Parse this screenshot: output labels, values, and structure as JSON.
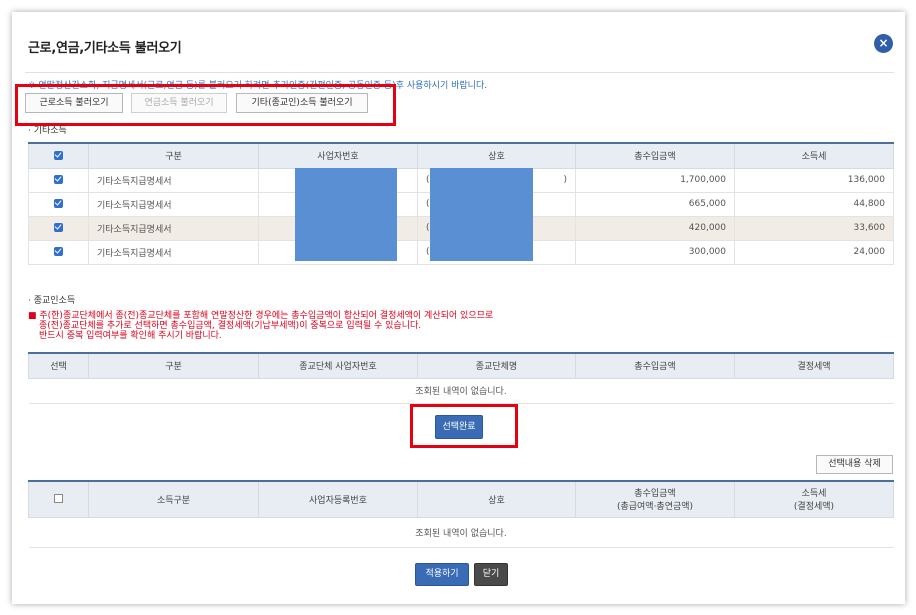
{
  "dialog": {
    "title": "근로,연금,기타소득 불러오기",
    "close_icon": "×",
    "notice": "※ 연말정산간소화, 지급명세서(근로,연금 등)를 불러오기 하려면 추가인증(간편인증, 공동인증 등)후 사용하시기 바랍니다."
  },
  "load_buttons": {
    "earned": "근로소득 불러오기",
    "pension": "연금소득 불러오기",
    "other": "기타(종교인)소득 불러오기"
  },
  "other_income": {
    "label": "· 기타소득",
    "headers": [
      "구분",
      "사업자번호",
      "상호",
      "총수입금액",
      "소득세"
    ],
    "rows": [
      {
        "type": "기타소득지급명세서",
        "biz_no": "",
        "name_prefix": "(",
        "name_suffix": ")",
        "total": "1,700,000",
        "tax": "136,000"
      },
      {
        "type": "기타소득지급명세서",
        "biz_no": "",
        "name_prefix": "(",
        "name_suffix": "",
        "total": "665,000",
        "tax": "44,800"
      },
      {
        "type": "기타소득지급명세서",
        "biz_no": "",
        "name_prefix": "(",
        "name_suffix": "",
        "total": "420,000",
        "tax": "33,600"
      },
      {
        "type": "기타소득지급명세서",
        "biz_no": "",
        "name_prefix": "(",
        "name_suffix": "",
        "total": "300,000",
        "tax": "24,000"
      }
    ]
  },
  "religious_income": {
    "label": "· 종교인소득",
    "warning_lines": [
      "■ 주(한)종교단체에서 종(전)종교단체를 포함해 연말정산한 경우에는 총수입금액이 합산되어 결정세액이 계산되어 있으므로",
      "종(전)종교단체를 추가로 선택하면 총수입금액, 결정세액(기납부세액)이 중복으로 입력될 수 있습니다.",
      "반드시 중복 입력여부를 확인해 주시기 바랍니다."
    ],
    "headers": [
      "선택",
      "구분",
      "종교단체 사업자번호",
      "종교단체명",
      "총수입금액",
      "결정세액"
    ],
    "empty_text": "조회된 내역이 없습니다.",
    "select_done": "선택완료"
  },
  "selected": {
    "delete_button": "선택내용 삭제",
    "headers": {
      "income_type": "소득구분",
      "biz_no": "사업자등록번호",
      "name": "상호",
      "total_line1": "총수입금액",
      "total_line2": "(총급여액·총연금액)",
      "tax_line1": "소득세",
      "tax_line2": "(결정세액)"
    },
    "empty_text": "조회된 내역이 없습니다."
  },
  "footer": {
    "apply": "적용하기",
    "close": "닫기"
  },
  "colors": {
    "accent_blue": "#3a6cb5",
    "highlight_red": "#e50012",
    "mask_blue": "#5b8fd4"
  }
}
